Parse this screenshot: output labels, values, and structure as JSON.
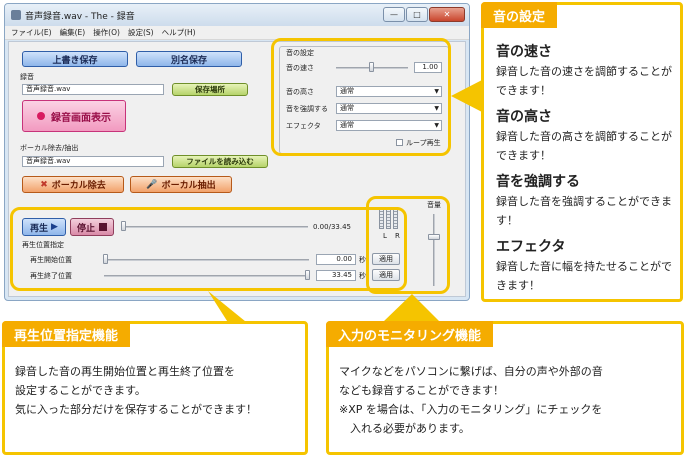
{
  "window": {
    "title": "音声録音.wav - The - 録音",
    "menu": [
      "ファイル(E)",
      "編集(E)",
      "操作(O)",
      "設定(S)",
      "ヘルプ(H)"
    ],
    "controls": {
      "minimize": "—",
      "maximize": "□",
      "close": "✕"
    }
  },
  "save": {
    "overwrite": "上書き保存",
    "save_as": "別名保存"
  },
  "record": {
    "label": "録音",
    "file": "音声録音.wav",
    "location_button": "保存場所",
    "screen_button": "録音画面表示"
  },
  "vocal": {
    "label": "ボーカル除去/抽出",
    "file": "音声録音.wav",
    "load_button": "ファイルを読み込む",
    "remove_button": "ボーカル除去",
    "extract_button": "ボーカル抽出"
  },
  "sound_settings": {
    "group_label": "音の設定",
    "speed_label": "音の速さ",
    "speed_value": "1.00",
    "pitch_label": "音の高さ",
    "pitch_value": "通常",
    "emphasis_label": "音を強調する",
    "emphasis_value": "通常",
    "effect_label": "エフェクタ",
    "effect_value": "通常",
    "loop_label": "ループ再生"
  },
  "playback": {
    "play_button": "再生",
    "stop_button": "停止",
    "time": "0.00/33.45",
    "range_label": "再生位置指定",
    "start_label": "再生開始位置",
    "start_value": "0.00",
    "end_label": "再生終了位置",
    "end_value": "33.45",
    "unit": "秒",
    "apply": "適用"
  },
  "volume": {
    "label": "音量",
    "left": "L",
    "right": "R"
  },
  "callouts": {
    "sound": {
      "title": "音の設定",
      "items": [
        {
          "heading": "音の速さ",
          "text": "録音した音の速さを調節することができます！"
        },
        {
          "heading": "音の高さ",
          "text": "録音した音の高さを調節することができます！"
        },
        {
          "heading": "音を強調する",
          "text": "録音した音を強調することができます！"
        },
        {
          "heading": "エフェクタ",
          "text": "録音した音に幅を持たせることができます！"
        }
      ]
    },
    "position": {
      "title": "再生位置指定機能",
      "text": "録音した音の再生開始位置と再生終了位置を\n設定することができます。\n気に入った部分だけを保存することができます！"
    },
    "monitor": {
      "title": "入力のモニタリング機能",
      "text": "マイクなどをパソコンに繋げば、自分の声や外部の音\nなども録音することができます！\n※XP を場合は、「入力のモニタリング」にチェックを\n　入れる必要があります。"
    }
  },
  "colors": {
    "accent": "#f5c400",
    "header": "#f5ac00"
  }
}
